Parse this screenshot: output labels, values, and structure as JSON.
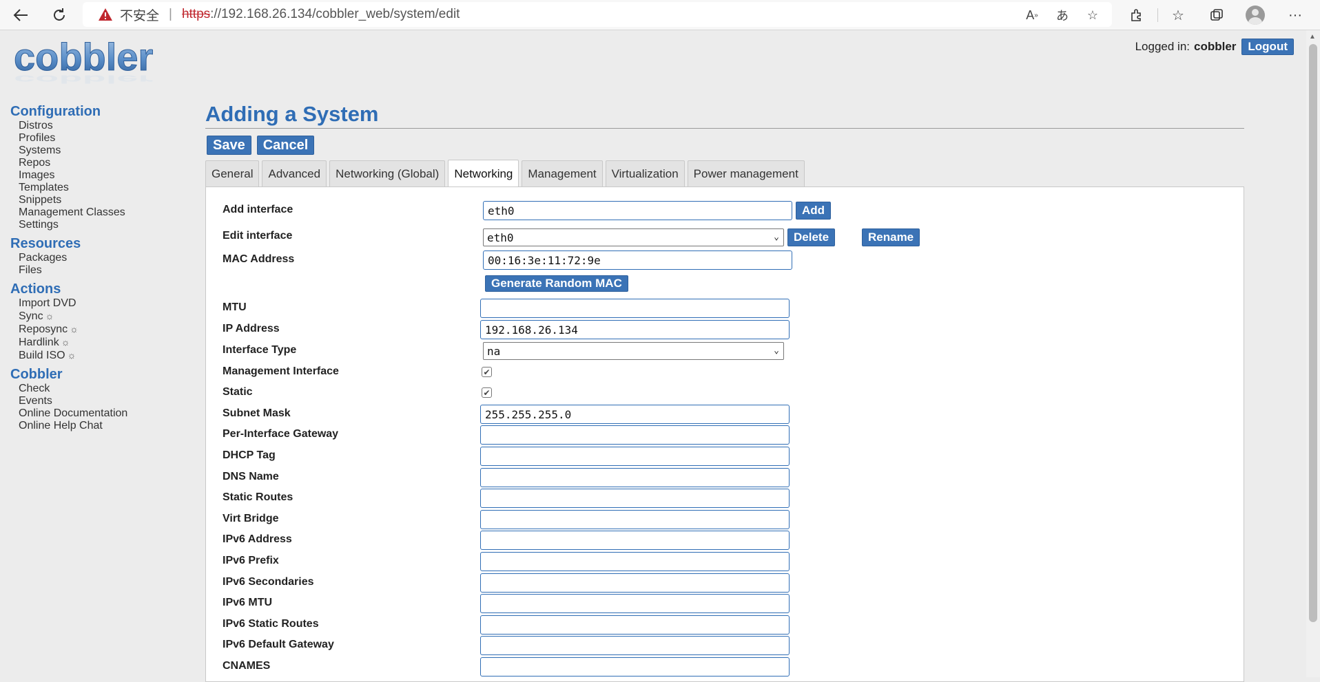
{
  "browser": {
    "insecure_label": "不安全",
    "url_protocol": "https",
    "url_rest": "://192.168.26.134/cobbler_web/system/edit"
  },
  "header": {
    "logo_text": "cobbler",
    "logged_in_label": "Logged in:",
    "username": "cobbler",
    "logout_label": "Logout"
  },
  "sidebar": {
    "sections": [
      {
        "title": "Configuration",
        "items": [
          "Distros",
          "Profiles",
          "Systems",
          "Repos",
          "Images",
          "Templates",
          "Snippets",
          "Management Classes",
          "Settings"
        ]
      },
      {
        "title": "Resources",
        "items": [
          "Packages",
          "Files"
        ]
      },
      {
        "title": "Actions",
        "items": [
          "Import DVD",
          "Sync",
          "Reposync",
          "Hardlink",
          "Build ISO"
        ]
      },
      {
        "title": "Cobbler",
        "items": [
          "Check",
          "Events",
          "Online Documentation",
          "Online Help Chat"
        ]
      }
    ],
    "gear_glyph": "☼"
  },
  "main": {
    "title": "Adding a System",
    "save_label": "Save",
    "cancel_label": "Cancel",
    "tabs": [
      "General",
      "Advanced",
      "Networking (Global)",
      "Networking",
      "Management",
      "Virtualization",
      "Power management"
    ],
    "active_tab": "Networking"
  },
  "form": {
    "add_interface": {
      "label": "Add interface",
      "value": "eth0",
      "button": "Add"
    },
    "edit_interface": {
      "label": "Edit interface",
      "value": "eth0",
      "delete": "Delete",
      "rename": "Rename"
    },
    "mac_address": {
      "label": "MAC Address",
      "value": "00:16:3e:11:72:9e",
      "button": "Generate Random MAC"
    },
    "mtu": {
      "label": "MTU",
      "value": ""
    },
    "ip_address": {
      "label": "IP Address",
      "value": "192.168.26.134"
    },
    "interface_type": {
      "label": "Interface Type",
      "value": "na"
    },
    "management_interface": {
      "label": "Management Interface",
      "checked": true
    },
    "static": {
      "label": "Static",
      "checked": true
    },
    "subnet_mask": {
      "label": "Subnet Mask",
      "value": "255.255.255.0"
    },
    "per_interface_gateway": {
      "label": "Per-Interface Gateway",
      "value": ""
    },
    "dhcp_tag": {
      "label": "DHCP Tag",
      "value": ""
    },
    "dns_name": {
      "label": "DNS Name",
      "value": ""
    },
    "static_routes": {
      "label": "Static Routes",
      "value": ""
    },
    "virt_bridge": {
      "label": "Virt Bridge",
      "value": ""
    },
    "ipv6_address": {
      "label": "IPv6 Address",
      "value": ""
    },
    "ipv6_prefix": {
      "label": "IPv6 Prefix",
      "value": ""
    },
    "ipv6_secondaries": {
      "label": "IPv6 Secondaries",
      "value": ""
    },
    "ipv6_mtu": {
      "label": "IPv6 MTU",
      "value": ""
    },
    "ipv6_static_routes": {
      "label": "IPv6 Static Routes",
      "value": ""
    },
    "ipv6_default_gateway": {
      "label": "IPv6 Default Gateway",
      "value": ""
    },
    "cnames": {
      "label": "CNAMES",
      "value": ""
    }
  },
  "colors": {
    "accent": "#2f6db5",
    "button": "#3b73b6",
    "insecure_red": "#c0282f"
  }
}
